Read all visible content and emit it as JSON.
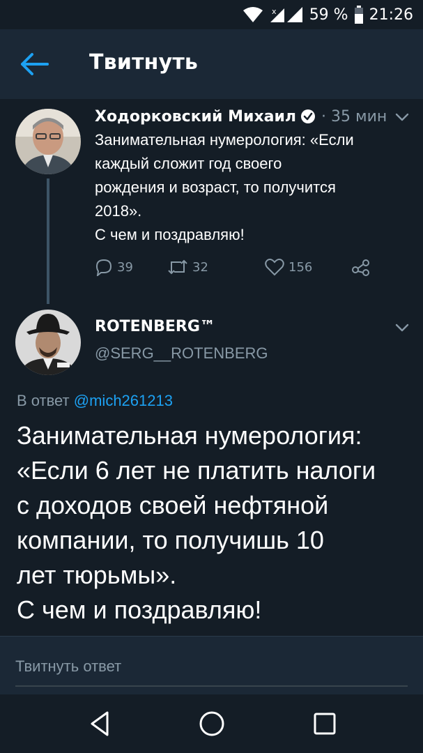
{
  "status_bar": {
    "battery_percent": "59 %",
    "time": "21:26"
  },
  "header": {
    "title": "Твитнуть"
  },
  "tweet1": {
    "author_name": "Ходорковский Михаил",
    "time": "· 35 мин",
    "text": "Занимательная нумерология: «Если\nкаждый сложит год своего\nрождения и возраст, то получится\n2018».\nС чем и поздравляю!",
    "replies": "39",
    "retweets": "32",
    "likes": "156"
  },
  "tweet2": {
    "author_name": "ROTENBERG™",
    "handle": "@SERG__ROTENBERG",
    "reply_prefix": "В ответ",
    "reply_mention": "@mich261213",
    "text": "Занимательная нумерология:\n«Если 6 лет не платить налоги\nс доходов своей нефтяной\nкомпании, то получишь 10\nлет тюрьмы».\nС чем и поздравляю!"
  },
  "compose": {
    "placeholder": "Твитнуть ответ"
  },
  "colors": {
    "background": "#141d26",
    "bar": "#1b2836",
    "accent": "#1da1f2",
    "muted": "#8899a6"
  },
  "icons": [
    "wifi-icon",
    "signal-icon",
    "battery-icon",
    "back-arrow-icon",
    "verified-icon",
    "chevron-down-icon",
    "reply-icon",
    "retweet-icon",
    "like-icon",
    "share-icon",
    "nav-back-icon",
    "nav-home-icon",
    "nav-recent-icon"
  ]
}
